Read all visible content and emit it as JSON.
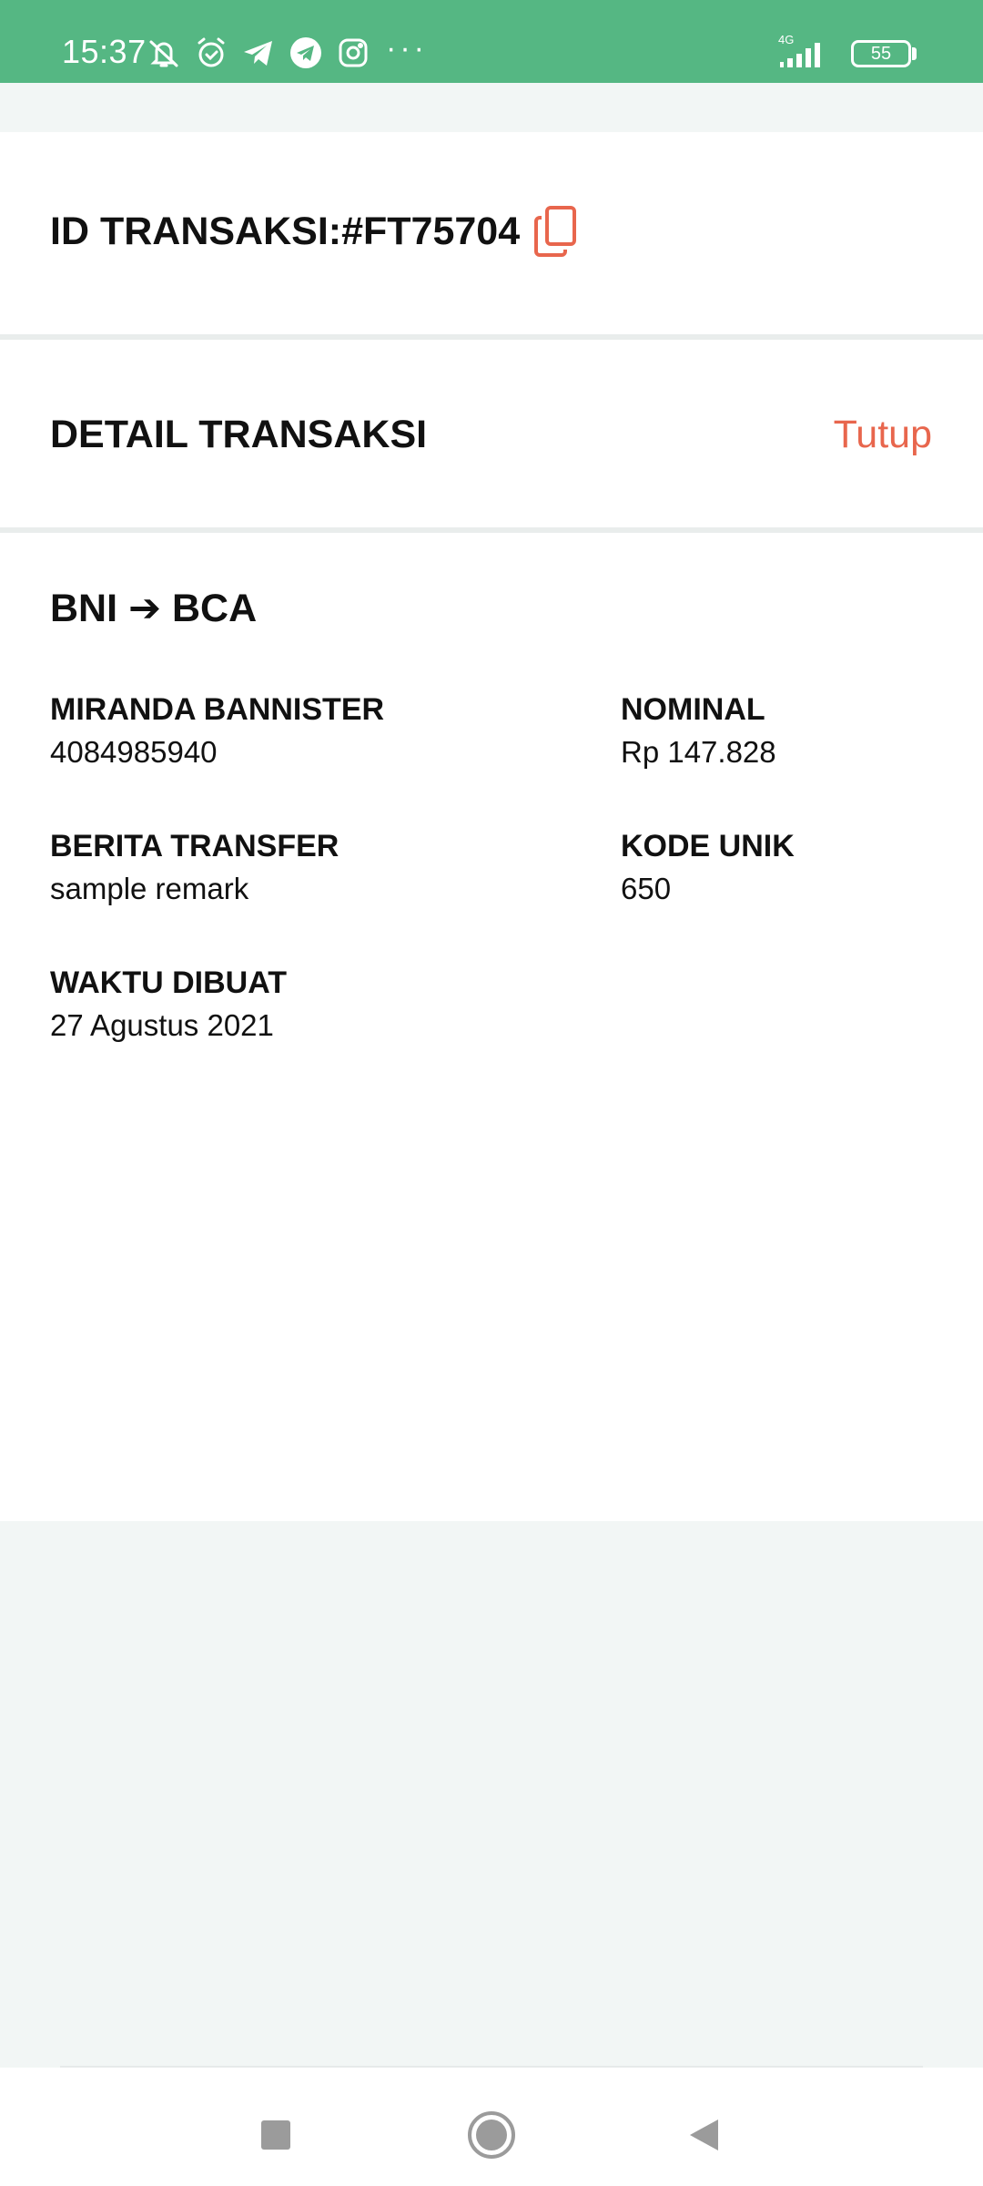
{
  "status_bar": {
    "time": "15:37",
    "icons": [
      "bell-off-icon",
      "alarm-icon",
      "telegram-icon",
      "telegram-circle-icon",
      "instagram-icon"
    ],
    "more": "···",
    "network": "4G",
    "battery": "55"
  },
  "transaction": {
    "id_label": "ID TRANSAKSI:#FT75704"
  },
  "header": {
    "title": "DETAIL TRANSAKSI",
    "close_label": "Tutup"
  },
  "detail": {
    "route": "BNI ➔ BCA",
    "recipient_name": "MIRANDA BANNISTER",
    "account_number": "4084985940",
    "nominal_label": "NOMINAL",
    "nominal_value": "Rp 147.828",
    "remark_label": "BERITA TRANSFER",
    "remark_value": "sample remark",
    "unique_code_label": "KODE UNIK",
    "unique_code_value": "650",
    "created_label": "WAKTU DIBUAT",
    "created_value": "27 Agustus 2021"
  },
  "colors": {
    "status_bar": "#55b783",
    "accent": "#e8664d",
    "background": "#f2f6f5"
  }
}
